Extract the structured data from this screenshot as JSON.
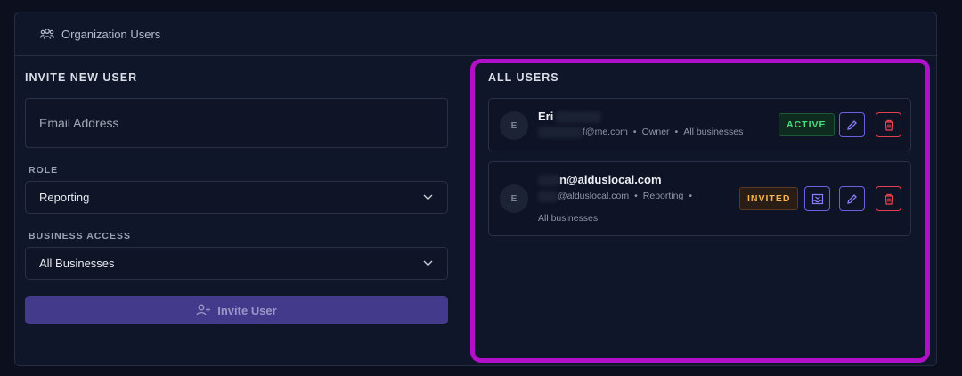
{
  "header": {
    "title": "Organization Users",
    "icon": "users-icon"
  },
  "invite": {
    "section_title": "INVITE NEW USER",
    "email_placeholder": "Email Address",
    "role_label": "ROLE",
    "role_value": "Reporting",
    "access_label": "BUSINESS ACCESS",
    "access_value": "All Businesses",
    "button_label": "Invite User"
  },
  "users": {
    "section_title": "ALL USERS",
    "items": [
      {
        "avatar": "E",
        "name": "Eri",
        "email": "f@me.com",
        "role": "Owner",
        "access": "All businesses",
        "status": "ACTIVE"
      },
      {
        "avatar": "E",
        "name": "n@alduslocal.com",
        "email": "@alduslocal.com",
        "role": "Reporting",
        "access": "All businesses",
        "status": "INVITED"
      }
    ]
  },
  "colors": {
    "accent": "#433a8c",
    "active": "#4ade80",
    "invited": "#f5b455",
    "danger": "#e0404f",
    "highlight": "#b010c8"
  }
}
